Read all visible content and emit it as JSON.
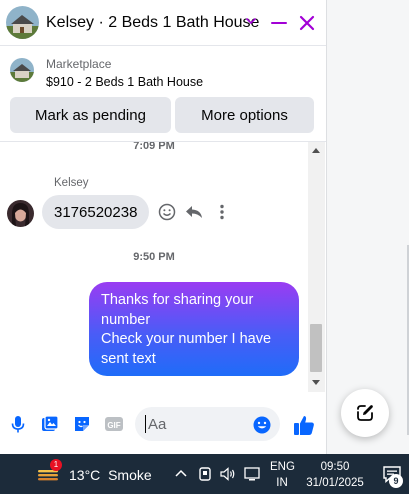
{
  "header": {
    "title": "Kelsey · 2 Beds 1 Bath House"
  },
  "listing": {
    "label": "Marketplace",
    "summary": "$910 - 2 Beds 1 Bath House"
  },
  "actions": {
    "mark_pending": "Mark as pending",
    "more_options": "More options"
  },
  "messages": {
    "timestamp_1": "7:09 PM",
    "sender_name": "Kelsey",
    "incoming_text": "3176520238",
    "timestamp_2": "9:50 PM",
    "outgoing_lines": [
      "Thanks for sharing your",
      "number",
      "Check your number I have",
      "sent text"
    ]
  },
  "composer": {
    "placeholder": "Aa",
    "gif_label": "GIF"
  },
  "taskbar": {
    "weather_temp": "13°C",
    "weather_desc": "Smoke",
    "weather_badge": "1",
    "lang_line1": "ENG",
    "lang_line2": "IN",
    "time": "09:50",
    "date": "31/01/2025",
    "notification_count": "9"
  },
  "colors": {
    "accent": "#a200d6",
    "blue": "#0866ff",
    "bubble_gradient_top": "#9a3cf2",
    "bubble_gradient_bottom": "#1f6cf8"
  }
}
